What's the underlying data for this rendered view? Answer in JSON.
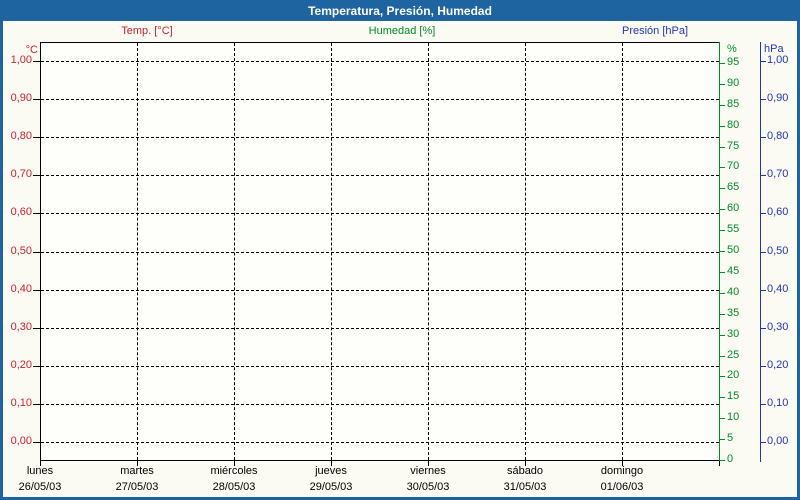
{
  "window": {
    "title": "Temperatura, Presión, Humedad"
  },
  "colors": {
    "titlebar": "#1E64A0",
    "background": "#FBFBF3",
    "temperature": "#CC2233",
    "humidity": "#008C28",
    "pressure": "#2233BB",
    "grid": "#000000"
  },
  "legend": {
    "temp": "Temp. [°C]",
    "humidity": "Humedad [%]",
    "pressure": "Presión [hPa]"
  },
  "chart_data": {
    "type": "line",
    "title": "Temperatura, Presión, Humedad",
    "note": "empty plot grid — no data points drawn for any series",
    "series": [
      {
        "name": "Temp. [°C]",
        "axis": "temperature_c",
        "color": "#CC2233",
        "values": []
      },
      {
        "name": "Humedad [%]",
        "axis": "humidity_percent",
        "color": "#008C28",
        "values": []
      },
      {
        "name": "Presión [hPa]",
        "axis": "pressure_hpa",
        "color": "#2233BB",
        "values": []
      }
    ],
    "grid": {
      "horizontal": "dashed",
      "vertical": "dashed"
    },
    "axes": {
      "temperature_c": {
        "header": "°C",
        "side": "left",
        "color": "#CC2233",
        "min": 0,
        "max": 1,
        "step": 0.1,
        "tick_labels": [
          "0,00",
          "0,10",
          "0,20",
          "0,30",
          "0,40",
          "0,50",
          "0,60",
          "0,70",
          "0,80",
          "0,90",
          "1,00"
        ]
      },
      "humidity_percent": {
        "header": "%",
        "side": "right",
        "color": "#008C28",
        "min": 0,
        "max": 100,
        "step": 5,
        "tick_labels": [
          "0",
          "5",
          "10",
          "15",
          "20",
          "25",
          "30",
          "35",
          "40",
          "45",
          "50",
          "55",
          "60",
          "65",
          "70",
          "75",
          "80",
          "85",
          "90",
          "95"
        ]
      },
      "pressure_hpa": {
        "header": "hPa",
        "side": "right",
        "color": "#2233BB",
        "min": 0,
        "max": 1,
        "step": 0.1,
        "tick_labels": [
          "0,00",
          "0,10",
          "0,20",
          "0,30",
          "0,40",
          "0,50",
          "0,60",
          "0,70",
          "0,80",
          "0,90",
          "1,00"
        ]
      },
      "x": {
        "days": [
          {
            "name": "lunes",
            "date": "26/05/03"
          },
          {
            "name": "martes",
            "date": "27/05/03"
          },
          {
            "name": "miércoles",
            "date": "28/05/03"
          },
          {
            "name": "jueves",
            "date": "29/05/03"
          },
          {
            "name": "viernes",
            "date": "30/05/03"
          },
          {
            "name": "sábado",
            "date": "31/05/03"
          },
          {
            "name": "domingo",
            "date": "01/06/03"
          }
        ]
      }
    }
  }
}
